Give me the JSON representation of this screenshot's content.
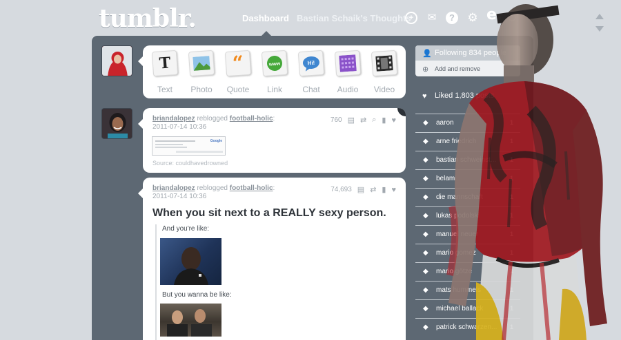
{
  "header": {
    "logo": "tumblr.",
    "nav": {
      "dashboard": "Dashboard",
      "blog": "Bastian Schaik's Thoughts"
    },
    "icons": [
      "plus-icon",
      "mail-icon",
      "help-icon",
      "gear-icon",
      "e-icon",
      "power-icon"
    ],
    "help_glyph": "?",
    "e_glyph": "e."
  },
  "post_types": [
    {
      "label": "Text",
      "icon": "text-icon"
    },
    {
      "label": "Photo",
      "icon": "photo-icon"
    },
    {
      "label": "Quote",
      "icon": "quote-icon"
    },
    {
      "label": "Link",
      "icon": "link-icon"
    },
    {
      "label": "Chat",
      "icon": "chat-icon"
    },
    {
      "label": "Audio",
      "icon": "audio-icon"
    },
    {
      "label": "Video",
      "icon": "video-icon"
    }
  ],
  "posts": [
    {
      "user": "briandalopez",
      "action": "reblogged",
      "source_user": "football-holic",
      "date": "2011-07-14 10:36",
      "notes": "760",
      "source_text": "Source: couldhavedrowned"
    },
    {
      "user": "briandalopez",
      "action": "reblogged",
      "source_user": "football-holic",
      "date": "2011-07-14 10:36",
      "notes": "74,693",
      "title": "When you sit next to a REALLY sexy person.",
      "line1": "And you're like:",
      "line2": "But you wanna be like:"
    }
  ],
  "sidebar": {
    "following": "Following 834 people",
    "add_remove": "Add and remove",
    "liked": "Liked 1,803 posts",
    "tags": [
      {
        "name": "aaron",
        "count": "1"
      },
      {
        "name": "arne friedrich",
        "count": "1"
      },
      {
        "name": "bastian schweinst...",
        "count": "1"
      },
      {
        "name": "belami",
        "count": "1"
      },
      {
        "name": "die mannschaft",
        "count": "1"
      },
      {
        "name": "lukas podolski",
        "count": "1"
      },
      {
        "name": "manuel neuer",
        "count": "1"
      },
      {
        "name": "mario gomez",
        "count": "1"
      },
      {
        "name": "mario götze",
        "count": "1"
      },
      {
        "name": "mats hummels",
        "count": "1"
      },
      {
        "name": "michael ballack",
        "count": "1"
      },
      {
        "name": "patrick schwarzen...",
        "count": "1"
      }
    ]
  },
  "colors": {
    "background": "#d6dadf",
    "container": "#5d6873",
    "accent_red": "#b4191f"
  }
}
